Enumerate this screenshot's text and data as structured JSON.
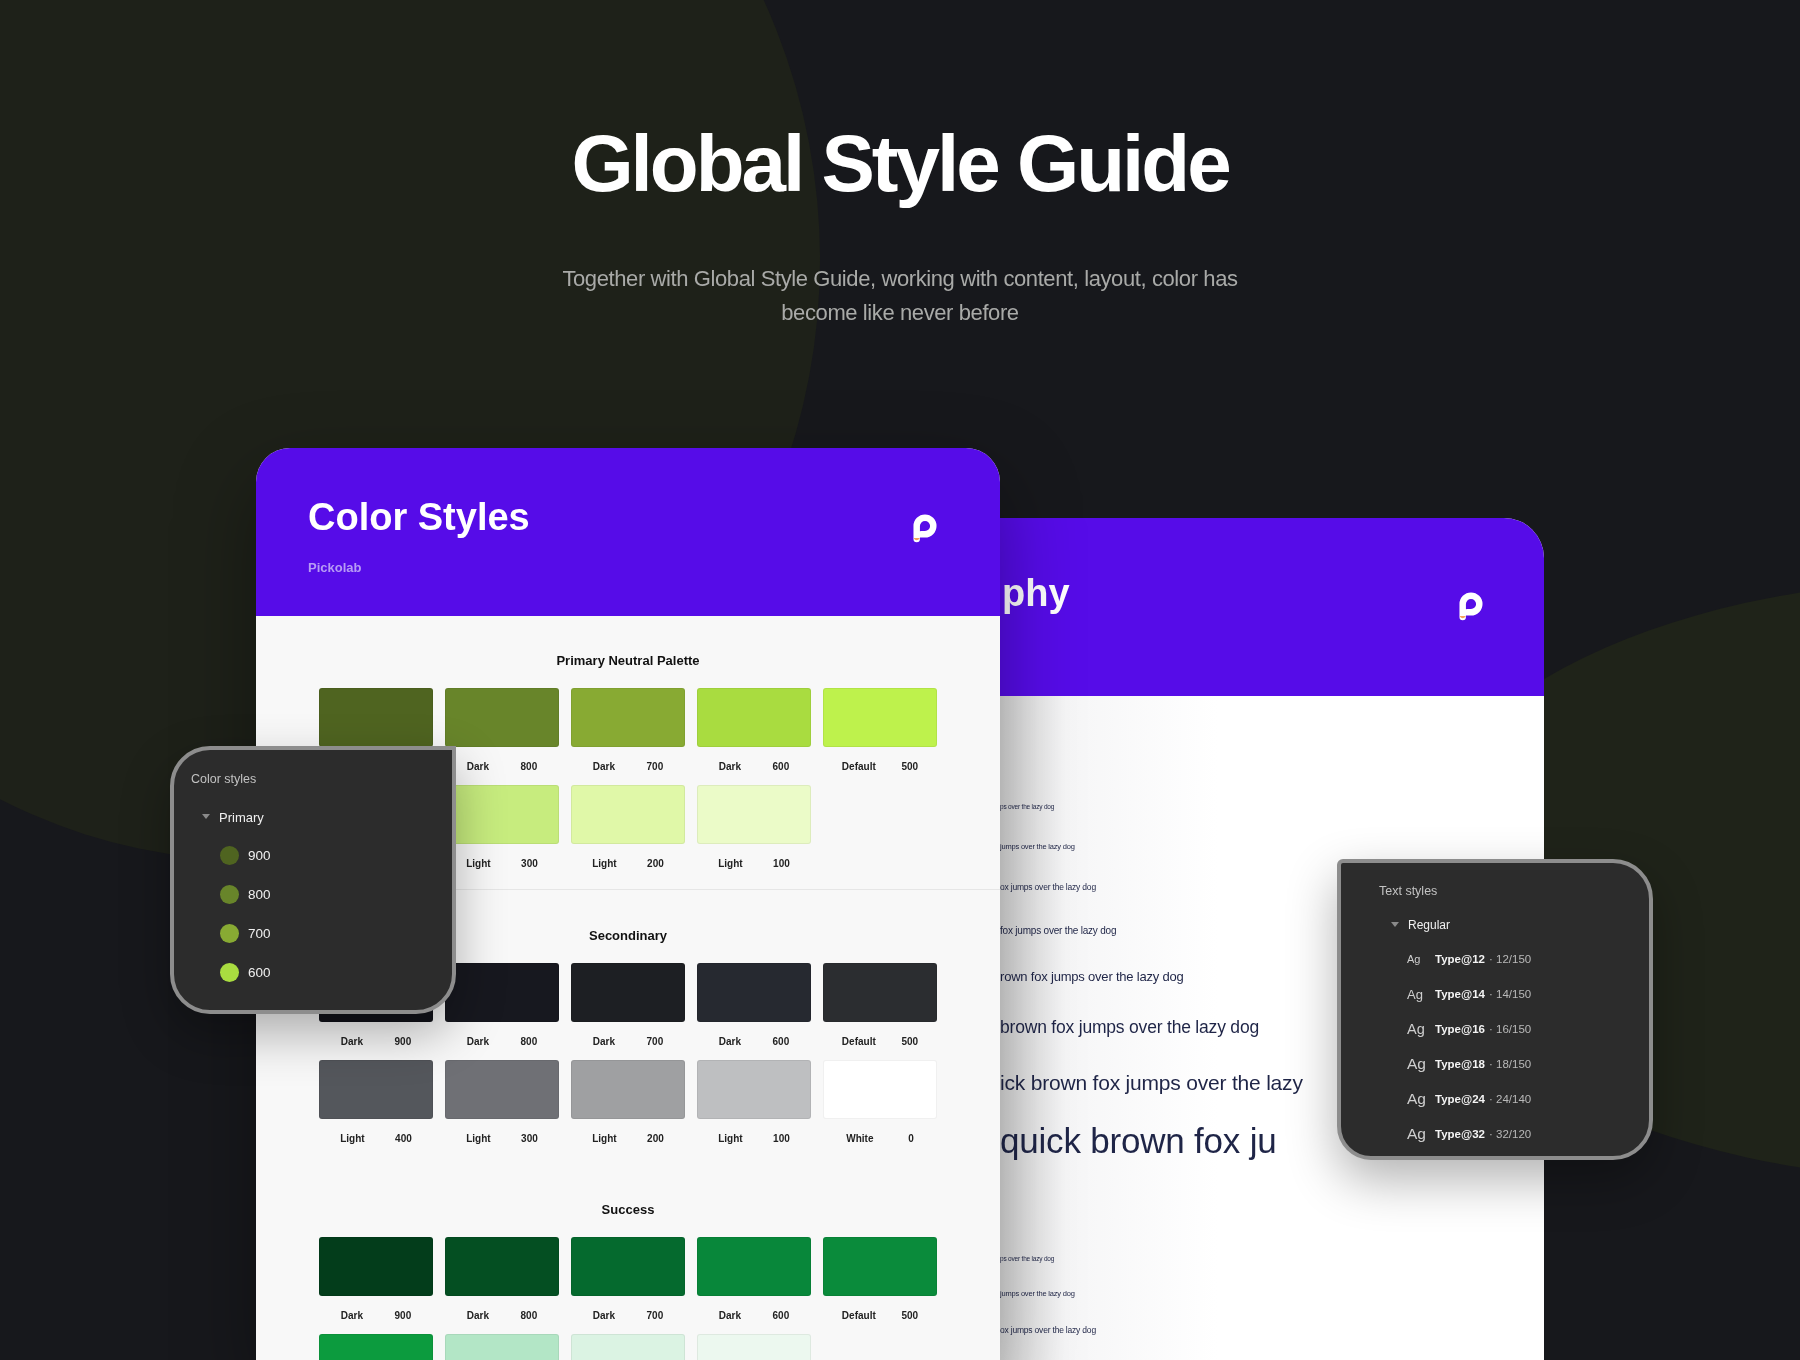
{
  "hero": {
    "title": "Global Style Guide",
    "subtitle": "Together with Global Style Guide, working with content, layout, color has become like never before"
  },
  "type_card": {
    "title": "phy",
    "samples": [
      "ps over the lazy dog",
      "jumps over the lazy dog",
      "ox jumps over the lazy dog",
      "fox jumps over the lazy dog",
      "rown fox jumps over the lazy dog",
      "brown fox jumps over the lazy dog",
      "ick brown fox jumps over the lazy",
      "quick brown fox ju"
    ],
    "samples_lower": [
      "ps over the lazy dog",
      "jumps over the lazy dog",
      "ox jumps over the lazy dog"
    ]
  },
  "color_card": {
    "title": "Color Styles",
    "brand": "Pickolab",
    "sections": [
      {
        "heading": "Primary Neutral Palette",
        "rows": [
          {
            "swatches": [
              {
                "color": "#4f6420"
              },
              {
                "color": "#68852a",
                "label": "Dark",
                "value": "800"
              },
              {
                "color": "#88aa33",
                "label": "Dark",
                "value": "700"
              },
              {
                "color": "#a9dc40",
                "label": "Dark",
                "value": "600"
              },
              {
                "color": "#bef24c",
                "label": "Default",
                "value": "500"
              }
            ]
          },
          {
            "kind": "offset",
            "swatches": [
              {
                "color": "#c7ec7e",
                "label": "Light",
                "value": "300"
              },
              {
                "color": "#e0f8a8",
                "label": "Light",
                "value": "200"
              },
              {
                "color": "#ebfbc8",
                "label": "Light",
                "value": "100"
              }
            ]
          }
        ]
      },
      {
        "heading": "Secondinary",
        "rows": [
          {
            "swatches": [
              {
                "color": "#12131a",
                "label": "Dark",
                "value": "900"
              },
              {
                "color": "#17181f",
                "label": "Dark",
                "value": "800"
              },
              {
                "color": "#1d1f23",
                "label": "Dark",
                "value": "700"
              },
              {
                "color": "#262930",
                "label": "Dark",
                "value": "600"
              },
              {
                "color": "#2b2d30",
                "label": "Default",
                "value": "500"
              }
            ]
          },
          {
            "swatches": [
              {
                "color": "#54575c",
                "label": "Light",
                "value": "400"
              },
              {
                "color": "#6f7075",
                "label": "Light",
                "value": "300"
              },
              {
                "color": "#9fa0a2",
                "label": "Light",
                "value": "200"
              },
              {
                "color": "#bebfc1",
                "label": "Light",
                "value": "100"
              },
              {
                "color": "#ffffff",
                "label": "White",
                "value": "0"
              }
            ]
          }
        ]
      },
      {
        "heading": "Success",
        "rows": [
          {
            "swatches": [
              {
                "color": "#033d1b",
                "label": "Dark",
                "value": "900"
              },
              {
                "color": "#044f22",
                "label": "Dark",
                "value": "800"
              },
              {
                "color": "#056a2e",
                "label": "Dark",
                "value": "700"
              },
              {
                "color": "#08873a",
                "label": "Dark",
                "value": "600"
              },
              {
                "color": "#0a8b3b",
                "label": "Default",
                "value": "500"
              }
            ]
          },
          {
            "swatches": [
              {
                "color": "#0c9b3e"
              },
              {
                "color": "#b3e6c6"
              },
              {
                "color": "#dbf3e3"
              },
              {
                "color": "#ecf8ef"
              }
            ]
          }
        ]
      }
    ]
  },
  "color_panel": {
    "title": "Color styles",
    "group": {
      "label": "Primary",
      "expanded": true,
      "items": [
        {
          "label": "900",
          "color": "#4f6420"
        },
        {
          "label": "800",
          "color": "#68852a"
        },
        {
          "label": "700",
          "color": "#88aa33"
        },
        {
          "label": "600",
          "color": "#a9dc40"
        }
      ]
    }
  },
  "text_panel": {
    "title": "Text styles",
    "group": {
      "label": "Regular",
      "expanded": true,
      "items": [
        {
          "glyph": "Ag",
          "name": "Type@12",
          "spec": "· 12/150"
        },
        {
          "glyph": "Ag",
          "name": "Type@14",
          "spec": "· 14/150"
        },
        {
          "glyph": "Ag",
          "name": "Type@16",
          "spec": "· 16/150"
        },
        {
          "glyph": "Ag",
          "name": "Type@18",
          "spec": "· 18/150"
        },
        {
          "glyph": "Ag",
          "name": "Type@24",
          "spec": "· 24/140"
        },
        {
          "glyph": "Ag",
          "name": "Type@32",
          "spec": "· 32/120"
        }
      ]
    }
  }
}
